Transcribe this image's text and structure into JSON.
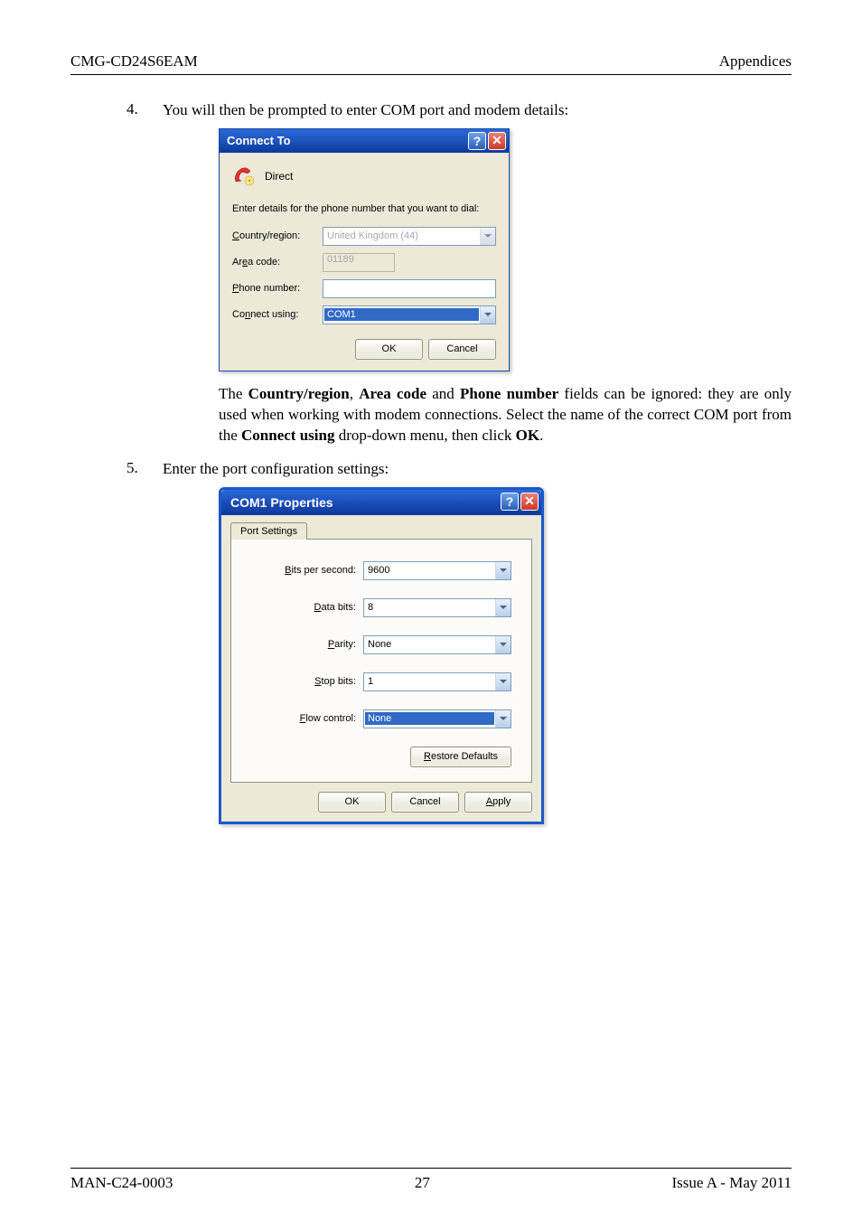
{
  "header": {
    "left": "CMG-CD24S6EAM",
    "right": "Appendices"
  },
  "items": [
    {
      "num": "4.",
      "text": "You will then be prompted to enter COM port and modem details:"
    },
    {
      "num": "5.",
      "text": "Enter the port configuration settings:"
    }
  ],
  "connect_to": {
    "title": "Connect To",
    "connection_name": "Direct",
    "hint": "Enter details for the phone number that you want to dial:",
    "fields": {
      "country_label_pre": "C",
      "country_label_rest": "ountry/region:",
      "country_value": "United Kingdom (44)",
      "area_label_pre": "Ar",
      "area_label_u": "e",
      "area_label_rest": "a code:",
      "area_value": "01189",
      "phone_label_u": "P",
      "phone_label_rest": "hone number:",
      "phone_value": "",
      "connect_label_pre": "Co",
      "connect_label_u": "n",
      "connect_label_rest": "nect using:",
      "connect_value": "COM1"
    },
    "buttons": {
      "ok": "OK",
      "cancel": "Cancel"
    }
  },
  "paragraph": {
    "t1": "The ",
    "b1": "Country/region",
    "t2": ", ",
    "b2": "Area code",
    "t3": " and ",
    "b3": "Phone number",
    "t4": " fields can be ignored: they are only used when working with modem connections.  Select the name of the correct COM port from the ",
    "b4": "Connect using",
    "t5": " drop-down menu, then click ",
    "b5": "OK",
    "t6": "."
  },
  "com1": {
    "title": "COM1 Properties",
    "tab": "Port Settings",
    "rows": {
      "bits_u": "B",
      "bits_rest": "its per second:",
      "bits_val": "9600",
      "data_u": "D",
      "data_rest": "ata bits:",
      "data_val": "8",
      "parity_u": "P",
      "parity_rest": "arity:",
      "parity_val": "None",
      "stop_u": "S",
      "stop_rest": "top bits:",
      "stop_val": "1",
      "flow_u": "F",
      "flow_rest": "low control:",
      "flow_val": "None"
    },
    "restore_u": "R",
    "restore_rest": "estore Defaults",
    "buttons": {
      "ok": "OK",
      "cancel": "Cancel",
      "apply_u": "A",
      "apply_rest": "pply"
    }
  },
  "footer": {
    "left": "MAN-C24-0003",
    "center": "27",
    "right": "Issue A  - May 2011"
  }
}
